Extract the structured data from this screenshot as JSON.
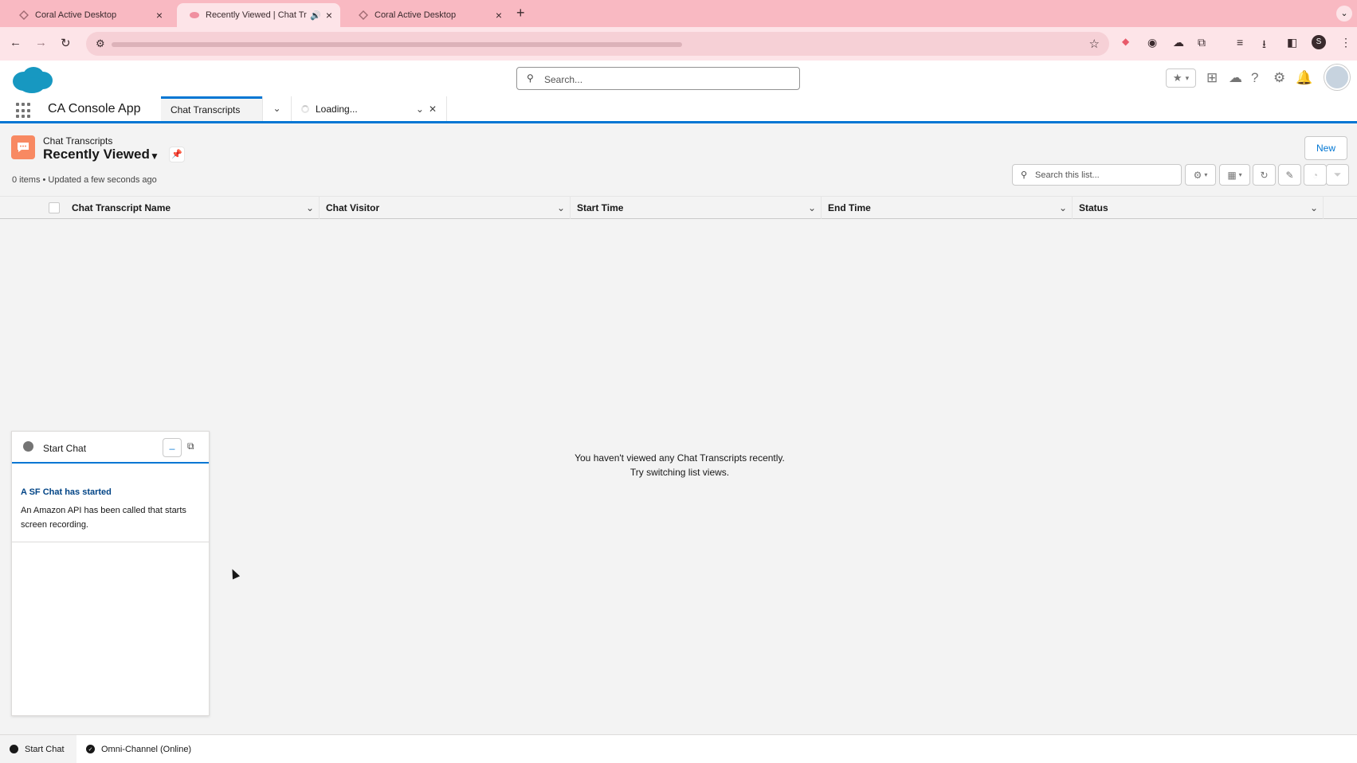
{
  "browser": {
    "tabs": [
      {
        "title": "Coral Active Desktop",
        "active": false
      },
      {
        "title": "Recently Viewed | Chat Tr",
        "active": true
      },
      {
        "title": "Coral Active Desktop",
        "active": false
      }
    ],
    "accent": "#f9b9c2"
  },
  "header": {
    "search_placeholder": "Search..."
  },
  "profile_initial": "S",
  "app": {
    "name": "CA Console App",
    "workspace_tabs": [
      {
        "label": "Chat Transcripts",
        "active": true
      },
      {
        "label": "Loading...",
        "active": false
      }
    ]
  },
  "list_view": {
    "object_label": "Chat Transcripts",
    "title": "Recently Viewed",
    "meta": "0 items • Updated a few seconds ago",
    "new_label": "New",
    "search_placeholder": "Search this list...",
    "columns": [
      "Chat Transcript Name",
      "Chat Visitor",
      "Start Time",
      "End Time",
      "Status"
    ],
    "empty_line1": "You haven't viewed any Chat Transcripts recently.",
    "empty_line2": "Try switching list views."
  },
  "chat_panel": {
    "title": "Start Chat",
    "card_title": "A SF Chat has started",
    "card_body": "An Amazon API has been called that starts screen recording."
  },
  "utility_bar": {
    "items": [
      "Start Chat",
      "Omni-Channel (Online)"
    ]
  },
  "colors": {
    "brand": "#0176d3",
    "object_icon": "#f88962"
  }
}
